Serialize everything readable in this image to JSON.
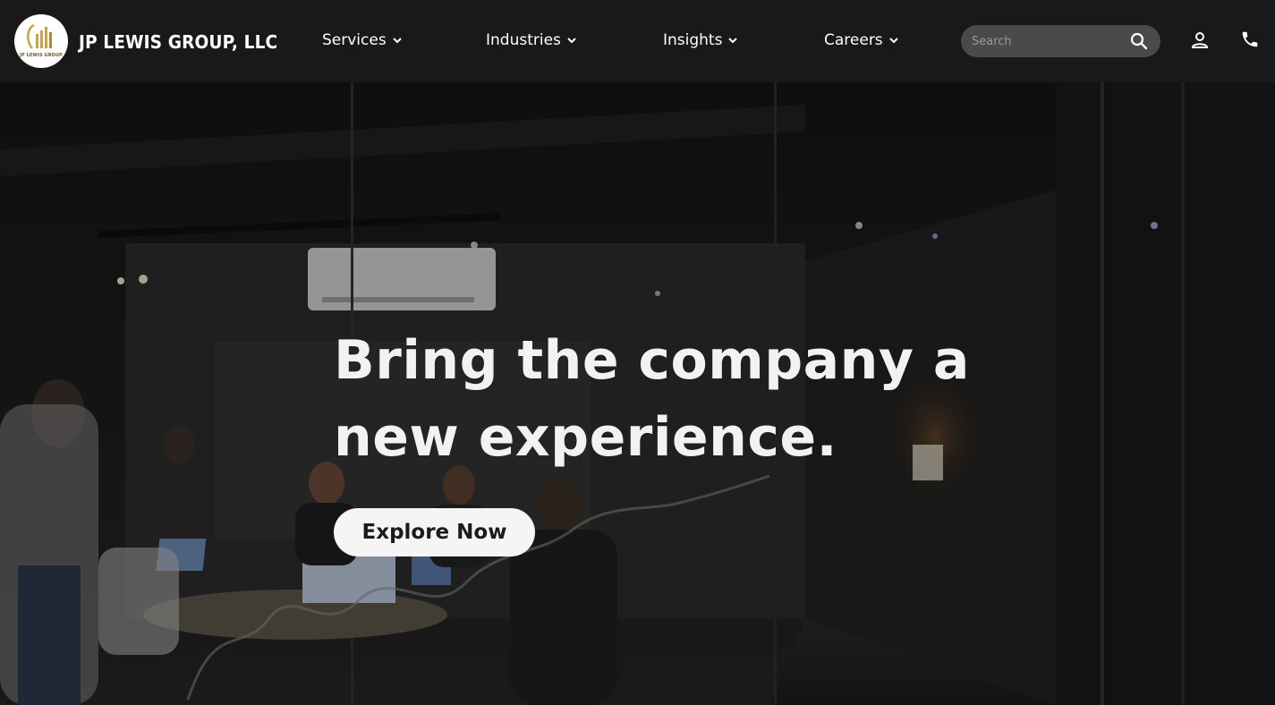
{
  "header": {
    "brand": "JP LEWIS GROUP, LLC",
    "logo_caption": "JP LEWIS GROUP",
    "nav": [
      {
        "label": "Services"
      },
      {
        "label": "Industries"
      },
      {
        "label": "Insights"
      },
      {
        "label": "Careers"
      }
    ],
    "search": {
      "placeholder": "Search",
      "value": ""
    },
    "icons": [
      "search-icon",
      "user-icon",
      "phone-icon",
      "chevron-down-icon"
    ]
  },
  "hero": {
    "title_line1": "Bring the company a",
    "title_line2": "new experience.",
    "cta_label": "Explore Now"
  },
  "colors": {
    "header_bg": "#1a1818",
    "search_bg": "#4a4a4a",
    "logo_gold": "#c9a24a",
    "cta_bg": "#f5f5f5",
    "cta_text": "#1a1a1a"
  }
}
